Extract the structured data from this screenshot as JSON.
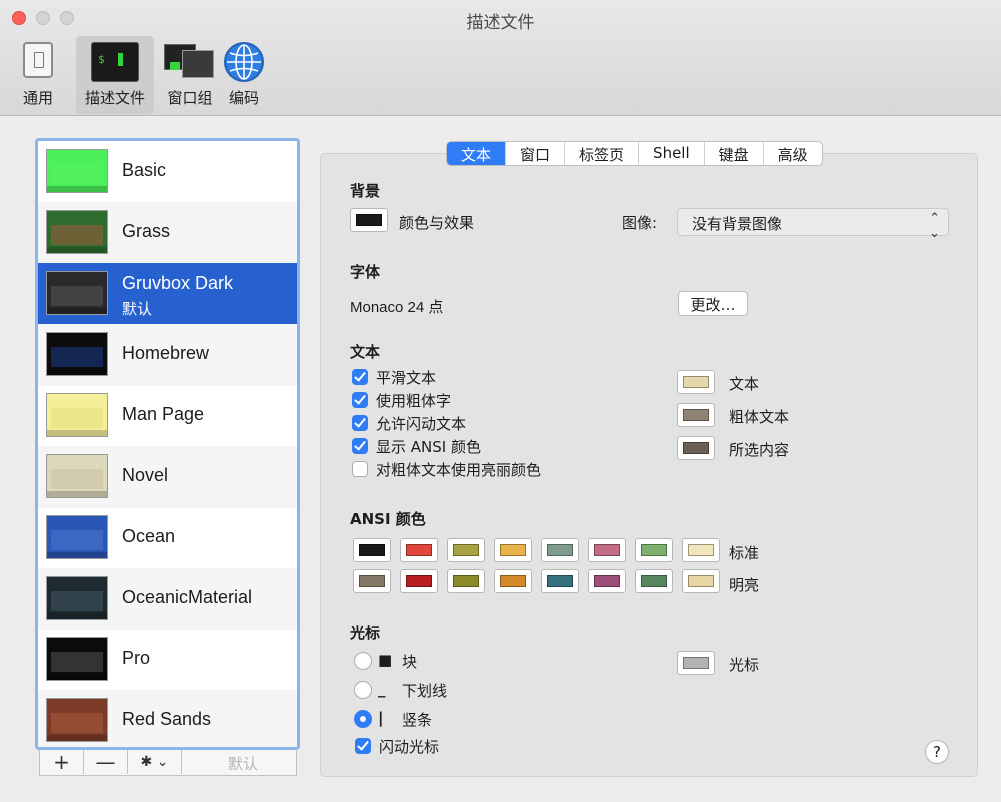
{
  "window": {
    "title": "描述文件"
  },
  "toolbar": [
    {
      "label": "通用",
      "icon": "general-icon"
    },
    {
      "label": "描述文件",
      "icon": "profiles-icon",
      "glyph": "$"
    },
    {
      "label": "窗口组",
      "icon": "window-groups-icon",
      "glyph": "$"
    },
    {
      "label": "编码",
      "icon": "encodings-globe-icon"
    }
  ],
  "profiles": [
    {
      "name": "Basic",
      "thumb_bg": "#4cf05a",
      "fg": "#111",
      "band": "#55f060"
    },
    {
      "name": "Grass",
      "thumb_bg": "#2d6b2f",
      "fg": "#e6e3a0",
      "band": "#a25a3a"
    },
    {
      "name": "Gruvbox Dark",
      "sub": "默认",
      "thumb_bg": "#2a2a2a",
      "fg": "#e8e8e8",
      "band": "#555"
    },
    {
      "name": "Homebrew",
      "thumb_bg": "#0c0c0c",
      "fg": "#35d53c",
      "band": "#1c3c8c"
    },
    {
      "name": "Man Page",
      "thumb_bg": "#f6ef9a",
      "fg": "#222",
      "band": "#e4dc7c"
    },
    {
      "name": "Novel",
      "thumb_bg": "#ddd7bc",
      "fg": "#6b3a25",
      "band": "#c9c1a0"
    },
    {
      "name": "Ocean",
      "thumb_bg": "#2a56b6",
      "fg": "#fff",
      "band": "#4b78d0"
    },
    {
      "name": "OceanicMaterial",
      "thumb_bg": "#1f2a30",
      "fg": "#e8e8e8",
      "band": "#3f5560"
    },
    {
      "name": "Pro",
      "thumb_bg": "#0b0b0b",
      "fg": "#e8e8e8",
      "band": "#555"
    },
    {
      "name": "Red Sands",
      "thumb_bg": "#7c3b29",
      "fg": "#e8d7b0",
      "band": "#a85c3c"
    }
  ],
  "listbar": {
    "add": "+",
    "remove": "—",
    "actions": "✱ ⌄",
    "default": "默认"
  },
  "tabs": [
    "文本",
    "窗口",
    "标签页",
    "Shell",
    "键盘",
    "高级"
  ],
  "background": {
    "heading": "背景",
    "color_effects": "颜色与效果",
    "color": "#1b1b1b",
    "image_label": "图像:",
    "image_value": "没有背景图像"
  },
  "font": {
    "heading": "字体",
    "value": "Monaco 24 点",
    "change": "更改…"
  },
  "text": {
    "heading": "文本",
    "options": [
      {
        "label": "平滑文本",
        "checked": true
      },
      {
        "label": "使用粗体字",
        "checked": true
      },
      {
        "label": "允许闪动文本",
        "checked": true
      },
      {
        "label": "显示 ANSI 颜色",
        "checked": true
      },
      {
        "label": "对粗体文本使用亮丽颜色",
        "checked": false
      }
    ],
    "colors": [
      {
        "label": "文本",
        "color": "#e3d7ac"
      },
      {
        "label": "粗体文本",
        "color": "#8e8272"
      },
      {
        "label": "所选内容",
        "color": "#6b6053"
      }
    ]
  },
  "ansi": {
    "heading": "ANSI 颜色",
    "normal_label": "标准",
    "bright_label": "明亮",
    "normal": [
      "#1a1a1a",
      "#e0463a",
      "#a7a244",
      "#e8b24a",
      "#7f9b8d",
      "#c26d85",
      "#7cb06c",
      "#f1e5bc"
    ],
    "bright": [
      "#867866",
      "#b81f23",
      "#8d8a2a",
      "#d38a2c",
      "#35727e",
      "#9c4f78",
      "#58875f",
      "#e8d7a4"
    ]
  },
  "cursor": {
    "heading": "光标",
    "options": [
      {
        "glyph": "■",
        "label": "块",
        "selected": false
      },
      {
        "glyph": "_",
        "label": "下划线",
        "selected": false
      },
      {
        "glyph": "|",
        "label": "竖条",
        "selected": true
      }
    ],
    "blink": "闪动光标",
    "color_label": "光标",
    "color": "#b3b3b3"
  },
  "help": "?"
}
